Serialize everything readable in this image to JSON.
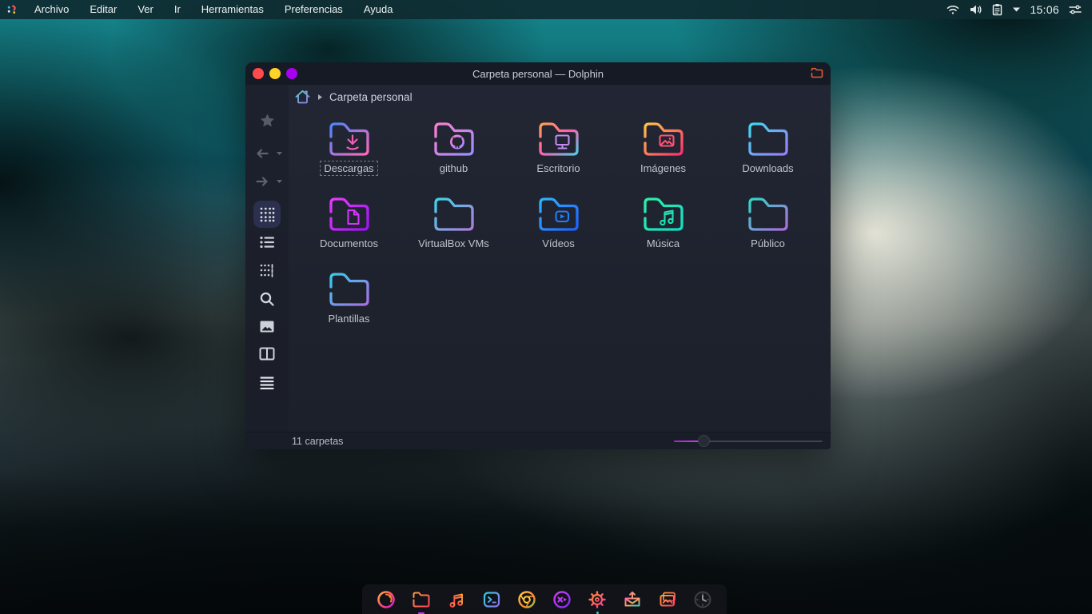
{
  "menubar": {
    "items": [
      "Archivo",
      "Editar",
      "Ver",
      "Ir",
      "Herramientas",
      "Preferencias",
      "Ayuda"
    ]
  },
  "tray": {
    "time": "15:06",
    "icons": [
      "wifi",
      "volume",
      "clipboard",
      "chevron-down",
      "tweaks"
    ]
  },
  "window": {
    "title": "Carpeta personal — Dolphin",
    "breadcrumb": {
      "root_label": "Carpeta personal"
    },
    "status_text": "11 carpetas",
    "traffic_light_colors": [
      "#ff4b4b",
      "#ffd426",
      "#a800f0"
    ],
    "accent_color": "#c83ce8",
    "zoom_slider_percent": 24,
    "selected_item": "Descargas",
    "folders": [
      {
        "label": "Descargas",
        "emblem": "download-arrow",
        "gradient": [
          "#4a86ff",
          "#ff66b8"
        ]
      },
      {
        "label": "github",
        "emblem": "github-octocat",
        "gradient": [
          "#ff7ed2",
          "#9c8cff"
        ]
      },
      {
        "label": "Escritorio",
        "emblem": "monitor",
        "gradient": [
          "#ffa050",
          "#ff5fae",
          "#4ecbe8"
        ]
      },
      {
        "label": "Imágenes",
        "emblem": "picture",
        "gradient": [
          "#ffc445",
          "#ff2e70"
        ]
      },
      {
        "label": "Downloads",
        "emblem": "none",
        "gradient": [
          "#3fd9ef",
          "#9a7cfa"
        ]
      },
      {
        "label": "Documentos",
        "emblem": "document",
        "gradient": [
          "#e93bff",
          "#9c14f0"
        ]
      },
      {
        "label": "VirtualBox VMs",
        "emblem": "none",
        "gradient": [
          "#3fd4e8",
          "#b27ae0"
        ]
      },
      {
        "label": "Vídeos",
        "emblem": "play",
        "gradient": [
          "#2fb4ff",
          "#1f5fff"
        ]
      },
      {
        "label": "Música",
        "emblem": "music-note",
        "gradient": [
          "#2df0a8",
          "#14d9c4"
        ]
      },
      {
        "label": "Público",
        "emblem": "none",
        "gradient": [
          "#2fd8c4",
          "#b168e0"
        ]
      },
      {
        "label": "Plantillas",
        "emblem": "none",
        "gradient": [
          "#38cdeb",
          "#a86ee4"
        ]
      }
    ],
    "sidebar_tools": [
      "bookmark-star",
      "back",
      "forward",
      "icons-view",
      "list-view",
      "compact-view",
      "search",
      "preview",
      "split-view",
      "menu"
    ]
  },
  "dock": {
    "items": [
      "firefox",
      "file-manager",
      "music-player",
      "terminal",
      "chromium",
      "media-player",
      "settings",
      "mail-share",
      "photos",
      "clock"
    ]
  }
}
